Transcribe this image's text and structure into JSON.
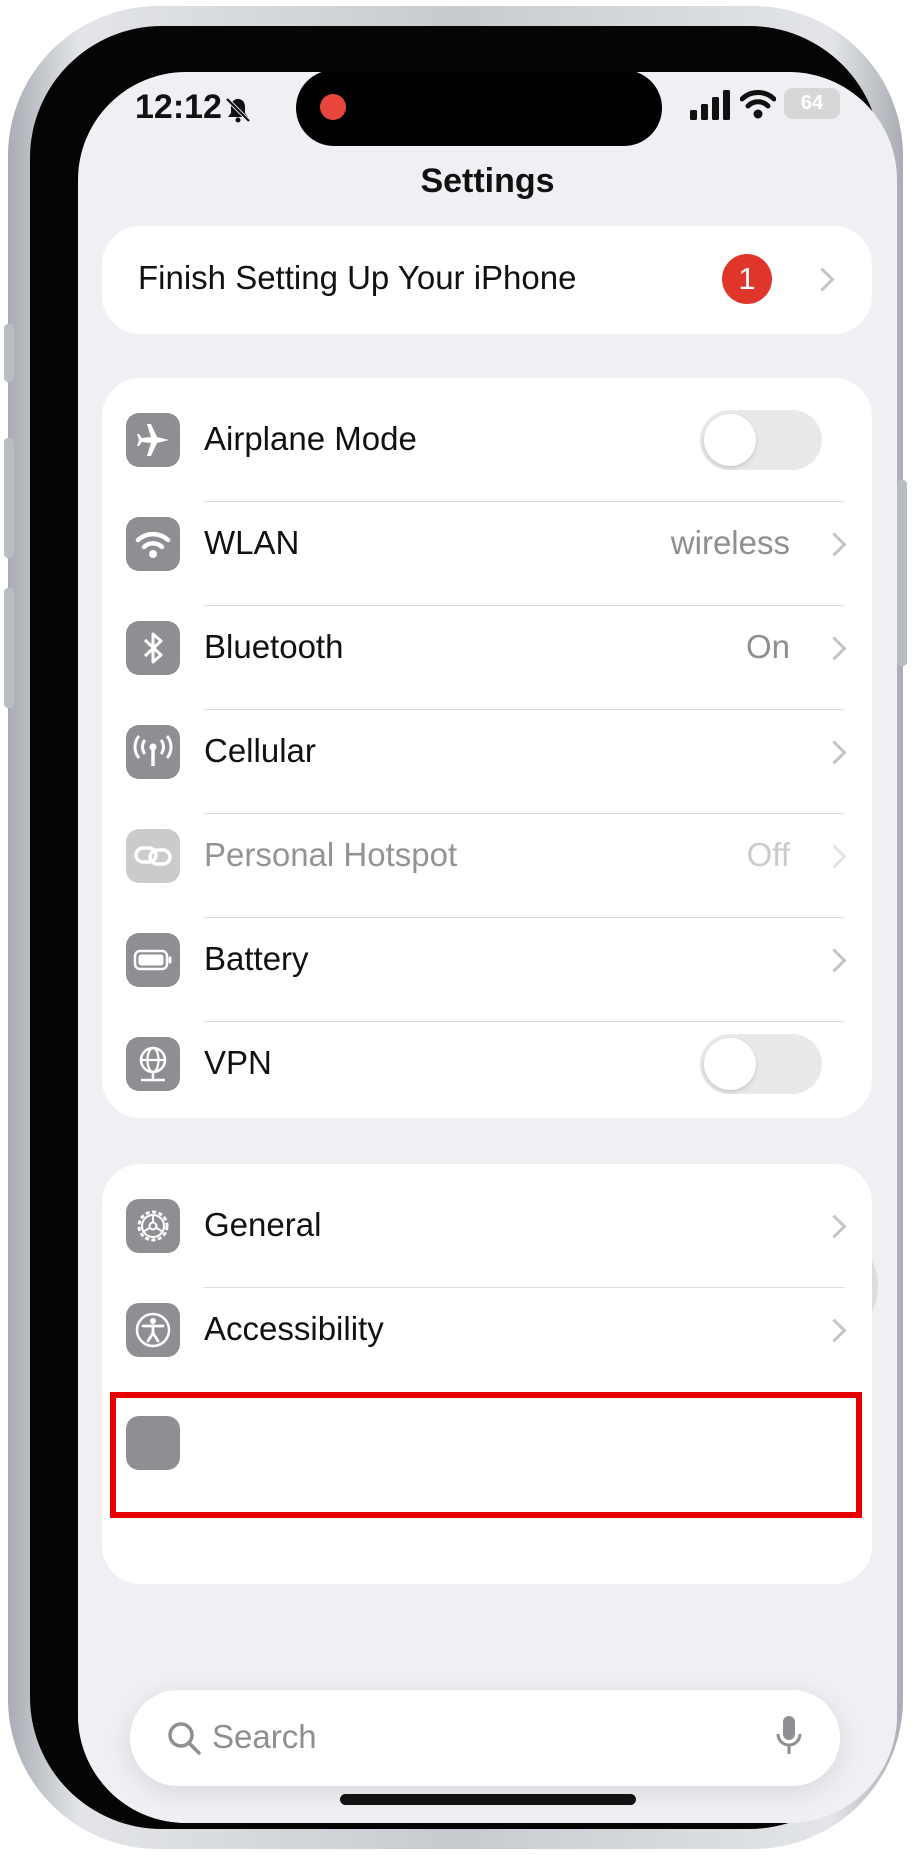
{
  "status_bar": {
    "time": "12:12",
    "battery_level": "64",
    "icons": [
      "bell-slash-icon",
      "recording-dot-icon",
      "cellular-signal-icon",
      "wifi-icon",
      "battery-icon"
    ]
  },
  "header": {
    "title": "Settings"
  },
  "setup_card": {
    "label": "Finish Setting Up Your iPhone",
    "badge": "1"
  },
  "connectivity": [
    {
      "label": "Airplane Mode",
      "icon": "airplane-icon",
      "control": "toggle",
      "on": false
    },
    {
      "label": "WLAN",
      "icon": "wifi-icon",
      "value": "wireless"
    },
    {
      "label": "Bluetooth",
      "icon": "bluetooth-icon",
      "value": "On"
    },
    {
      "label": "Cellular",
      "icon": "antenna-icon"
    },
    {
      "label": "Personal Hotspot",
      "icon": "hotspot-link-icon",
      "value": "Off",
      "disabled": true
    },
    {
      "label": "Battery",
      "icon": "battery-icon"
    },
    {
      "label": "VPN",
      "icon": "globe-icon",
      "control": "toggle",
      "on": false
    }
  ],
  "general_group": [
    {
      "label": "General",
      "icon": "gear-icon",
      "highlighted": true
    },
    {
      "label": "Accessibility",
      "icon": "accessibility-icon"
    }
  ],
  "search": {
    "placeholder": "Search"
  },
  "colors": {
    "badge": "#e0352b",
    "highlight_box": "#e60000",
    "icon_bg": "#8e8e93",
    "background": "#efeff4"
  }
}
